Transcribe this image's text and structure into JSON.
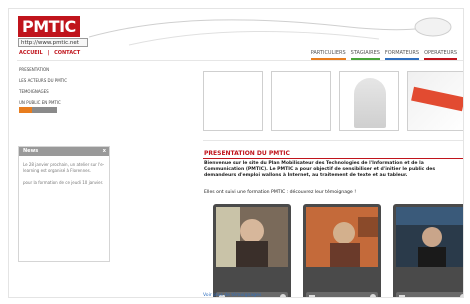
{
  "header": {
    "logo_text": "PMTIC",
    "logo_url": "http://www.pmtic.net"
  },
  "topnav": {
    "accueil": "ACCUEIL",
    "sep": "|",
    "contact": "CONTACT"
  },
  "tabs": [
    {
      "label": "PARTICULIERS",
      "color": "#e87d1e"
    },
    {
      "label": "STAGIAIRES",
      "color": "#4aa53c"
    },
    {
      "label": "FORMATEURS",
      "color": "#2f6fbf"
    },
    {
      "label": "OPERATEURS",
      "color": "#c0141c"
    }
  ],
  "leftmenu": [
    "PRESENTATION",
    "LES ACTEURS DU PMTIC",
    "TEMOIGNAGES",
    "UN PUBLIC EN PMTIC"
  ],
  "news": {
    "title": "News",
    "close": "x",
    "items": [
      "Le 28 janvier prochain, un atelier sur l'e-learning est organisé à Florennes.",
      "pour la formation de ce jeudi 10 janvier."
    ]
  },
  "section": {
    "title": "PRESENTATION DU PMTIC",
    "intro": "Bienvenue sur le site du Plan Mobilisateur des Technologies de l'Information et de la Communication (PMTIC). Le PMTIC a pour objectif de sensibiliser et d'initier le public des demandeurs d'emploi wallons à Internet, au traitement de texte et au tableur.",
    "intro2": "Elles ont suivi une formation PMTIC : découvrez leur témoignage !"
  },
  "footlink": "Voir plus de témoignages",
  "colors": {
    "brand_red": "#c0141c",
    "accent_orange": "#e87d1e"
  }
}
